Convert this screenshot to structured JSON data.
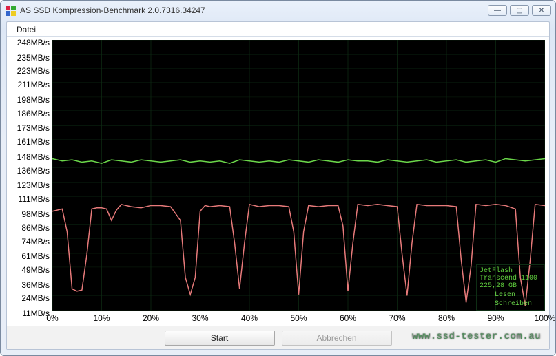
{
  "window": {
    "title": "AS SSD Kompression-Benchmark 2.0.7316.34247"
  },
  "menubar": {
    "items": [
      "Datei"
    ]
  },
  "buttons": {
    "start": "Start",
    "abort": "Abbrechen"
  },
  "legend": {
    "device": "JetFlash Transcend 1100",
    "capacity": "225,28 GB",
    "read": "Lesen",
    "write": "Schreiben"
  },
  "watermark": "www.ssd-tester.com.au",
  "chart_data": {
    "type": "line",
    "xlabel": "",
    "ylabel": "",
    "x_ticks": [
      "0%",
      "10%",
      "20%",
      "30%",
      "40%",
      "50%",
      "60%",
      "70%",
      "80%",
      "90%",
      "100%"
    ],
    "y_ticks": [
      "11MB/s",
      "24MB/s",
      "36MB/s",
      "49MB/s",
      "61MB/s",
      "74MB/s",
      "86MB/s",
      "98MB/s",
      "111MB/s",
      "123MB/s",
      "136MB/s",
      "148MB/s",
      "161MB/s",
      "173MB/s",
      "186MB/s",
      "198MB/s",
      "211MB/s",
      "223MB/s",
      "235MB/s",
      "248MB/s"
    ],
    "xlim": [
      0,
      100
    ],
    "ylim": [
      11,
      248
    ],
    "series": [
      {
        "name": "Lesen",
        "color": "#6bd84a",
        "x": [
          0,
          2,
          4,
          6,
          8,
          10,
          12,
          14,
          16,
          18,
          20,
          22,
          24,
          26,
          28,
          30,
          32,
          34,
          36,
          38,
          40,
          42,
          44,
          46,
          48,
          50,
          52,
          54,
          56,
          58,
          60,
          62,
          64,
          66,
          68,
          70,
          72,
          74,
          76,
          78,
          80,
          82,
          84,
          86,
          88,
          90,
          92,
          94,
          96,
          98,
          100
        ],
        "y": [
          144,
          142,
          143,
          141,
          142,
          140,
          143,
          142,
          141,
          143,
          142,
          141,
          142,
          143,
          141,
          142,
          141,
          142,
          140,
          143,
          142,
          141,
          142,
          141,
          143,
          142,
          141,
          143,
          142,
          141,
          143,
          142,
          142,
          141,
          143,
          142,
          141,
          142,
          143,
          141,
          142,
          143,
          141,
          142,
          143,
          141,
          144,
          143,
          142,
          143,
          144
        ]
      },
      {
        "name": "Schreiben",
        "color": "#e77a7a",
        "x": [
          0,
          2,
          3,
          4,
          5,
          6,
          7,
          8,
          9,
          10,
          11,
          12,
          13,
          14,
          16,
          18,
          20,
          22,
          24,
          26,
          27,
          28,
          29,
          30,
          31,
          32,
          34,
          36,
          37,
          38,
          39,
          40,
          41,
          42,
          44,
          46,
          48,
          49,
          50,
          51,
          52,
          54,
          56,
          58,
          59,
          60,
          61,
          62,
          64,
          66,
          68,
          70,
          71,
          72,
          73,
          74,
          76,
          78,
          80,
          82,
          83,
          84,
          85,
          86,
          88,
          90,
          92,
          94,
          95,
          96,
          97,
          98,
          100
        ],
        "y": [
          98,
          100,
          80,
          30,
          28,
          29,
          60,
          100,
          101,
          101,
          100,
          90,
          99,
          104,
          102,
          101,
          103,
          103,
          102,
          90,
          40,
          25,
          40,
          98,
          103,
          102,
          103,
          102,
          70,
          30,
          70,
          104,
          103,
          102,
          103,
          103,
          102,
          80,
          25,
          80,
          103,
          102,
          103,
          103,
          85,
          28,
          70,
          104,
          103,
          104,
          103,
          102,
          60,
          24,
          70,
          104,
          103,
          103,
          103,
          102,
          55,
          18,
          50,
          104,
          103,
          104,
          103,
          100,
          40,
          15,
          55,
          104,
          103
        ]
      }
    ]
  }
}
